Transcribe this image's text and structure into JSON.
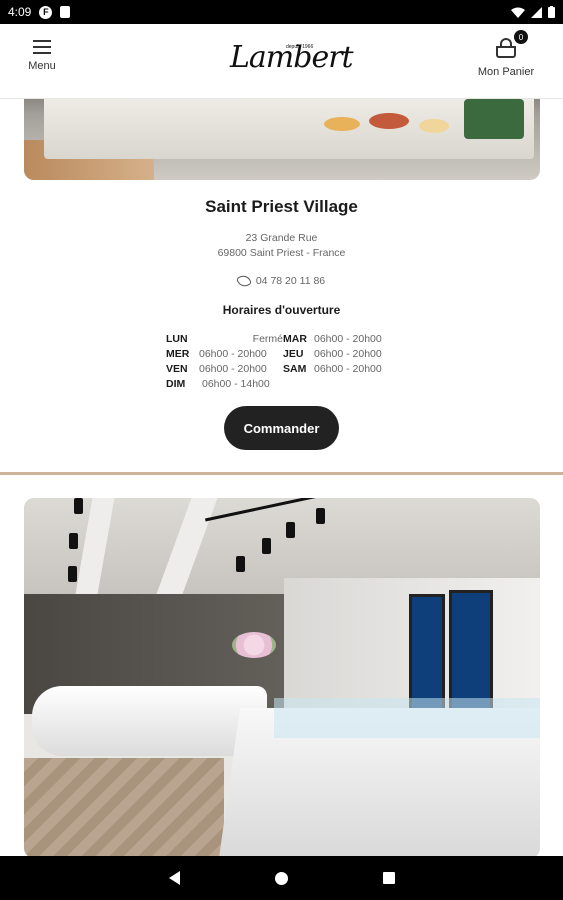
{
  "status_bar": {
    "time": "4:09",
    "app_badge": "F"
  },
  "header": {
    "menu_label": "Menu",
    "logo_text": "Lambert",
    "logo_since": "depuis 1966",
    "cart_label": "Mon Panier",
    "cart_count": "0"
  },
  "shop": {
    "name": "Saint Priest Village",
    "address_line1": "23 Grande Rue",
    "address_line2": "69800 Saint Priest - France",
    "phone": "04 78 20 11 86",
    "hours_title": "Horaires d'ouverture",
    "hours": [
      {
        "day": "LUN",
        "time": "Fermé"
      },
      {
        "day": "MAR",
        "time": "06h00 - 20h00"
      },
      {
        "day": "MER",
        "time": "06h00 - 20h00"
      },
      {
        "day": "JEU",
        "time": "06h00 - 20h00"
      },
      {
        "day": "VEN",
        "time": "06h00 - 20h00"
      },
      {
        "day": "SAM",
        "time": "06h00 - 20h00"
      },
      {
        "day": "DIM",
        "time": "06h00 - 14h00"
      }
    ],
    "order_button": "Commander"
  },
  "colors": {
    "accent_divider": "#cdb39a",
    "button_bg": "#222222"
  },
  "icons": {
    "menu": "hamburger-icon",
    "cart": "basket-icon",
    "phone": "phone-icon",
    "nav_back": "back-triangle-icon",
    "nav_home": "home-circle-icon",
    "nav_recent": "recent-square-icon"
  }
}
